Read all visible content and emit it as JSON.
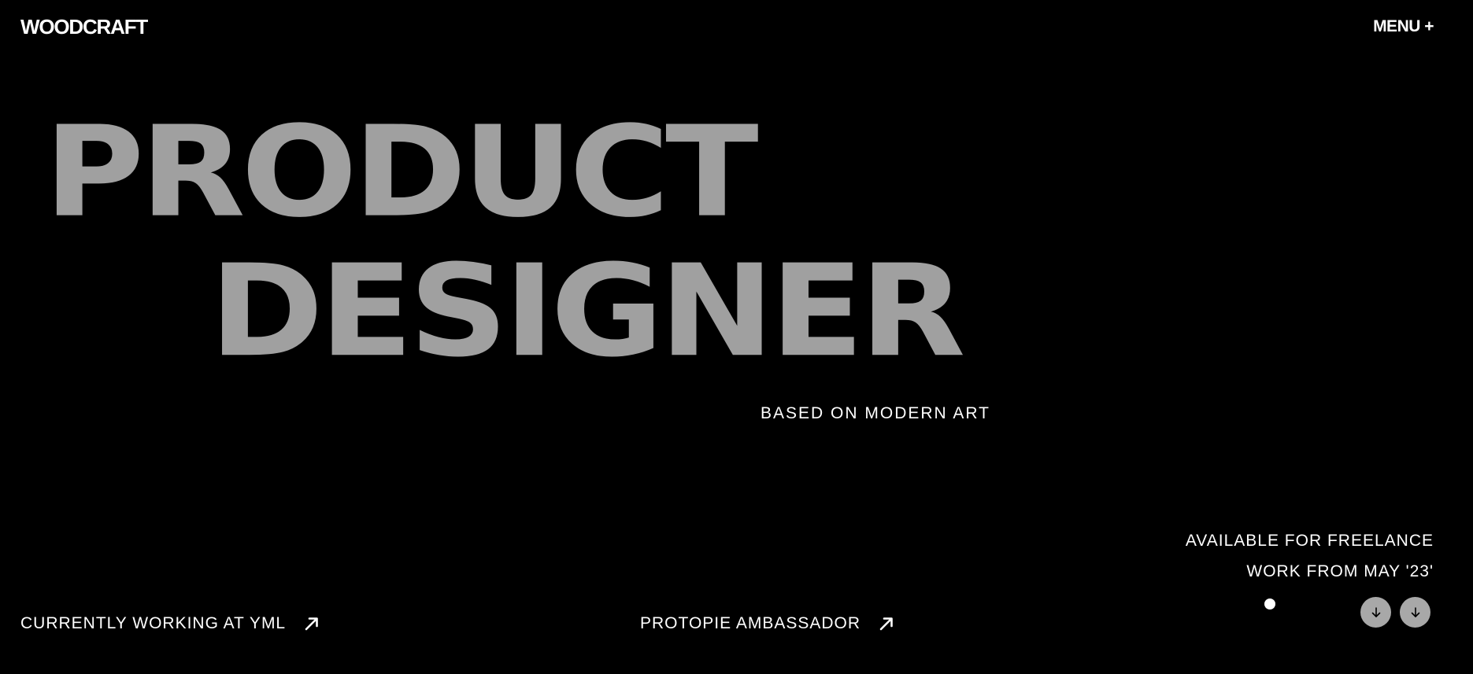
{
  "header": {
    "logo": "WOODCRAFT",
    "menu_label": "MENU +"
  },
  "hero": {
    "line_1": "PRODUCT",
    "line_2": "DESIGNER",
    "tagline": "BASED ON MODERN ART"
  },
  "availability": {
    "line_1": "AVAILABLE FOR FREELANCE",
    "line_2": "WORK FROM MAY '23'"
  },
  "footer_links": {
    "yml": "CURRENTLY WORKING AT YML",
    "protopie": "PROTOPIE AMBASSADOR"
  },
  "icons": {
    "link_arrow": "arrow-up-right-icon",
    "scroll_arrow": "arrow-down-icon"
  },
  "colors": {
    "background": "#000000",
    "hero_text": "#a0a0a0",
    "text": "#ffffff",
    "button_bg": "#a8a8a8"
  }
}
